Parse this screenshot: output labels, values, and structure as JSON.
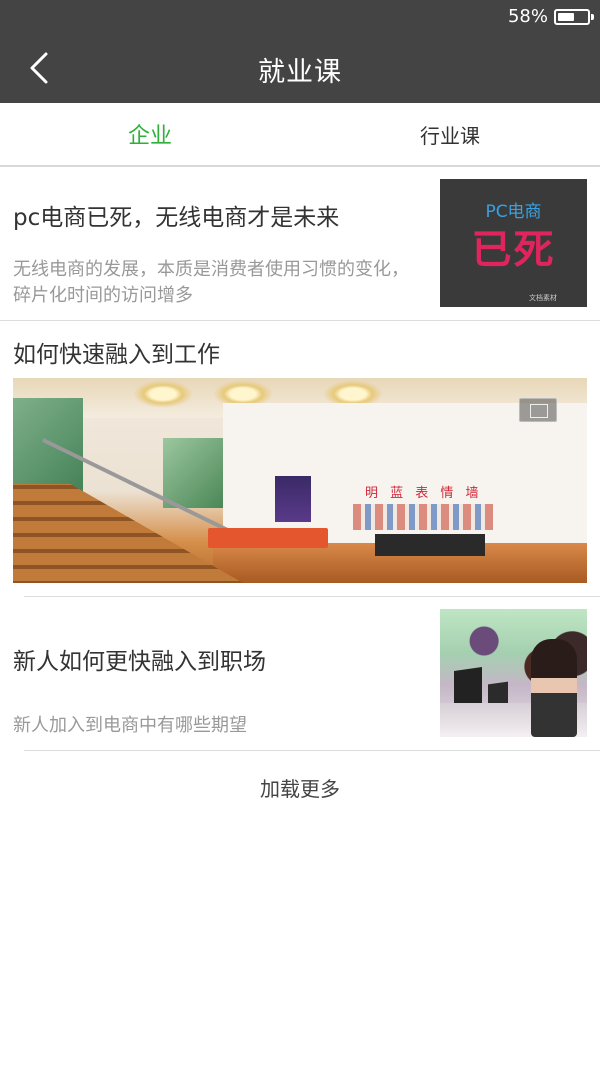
{
  "status_bar": {
    "battery_percent_text": "58%",
    "battery_level": 0.58
  },
  "header": {
    "title": "就业课"
  },
  "tabs": [
    {
      "label": "企业",
      "active": true
    },
    {
      "label": "行业课",
      "active": false
    }
  ],
  "articles": [
    {
      "title": "pc电商已死，无线电商才是未来",
      "description": "无线电商的发展，本质是消费者使用习惯的变化，碎片化时间的访问增多",
      "thumbnail_text": {
        "top": "PC电商",
        "main": "已死",
        "small": "文档素材"
      }
    }
  ],
  "feature": {
    "title": "如何快速融入到工作",
    "image_wall_text": "明 蓝 表 情 墙"
  },
  "articles_2": [
    {
      "title": "新人如何更快融入到职场",
      "description": "新人加入到电商中有哪些期望"
    }
  ],
  "load_more_label": "加载更多",
  "colors": {
    "header_bg": "#444444",
    "active_tab": "#2eb03a",
    "title_text": "#333333",
    "desc_text": "#999999"
  }
}
